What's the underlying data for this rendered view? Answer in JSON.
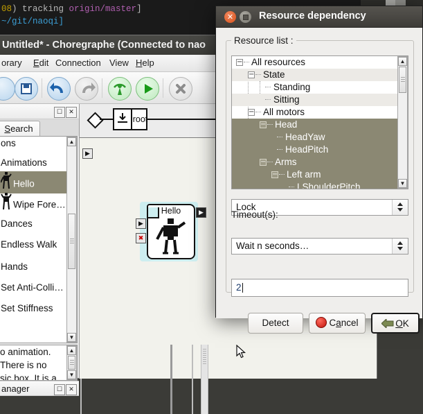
{
  "terminal": {
    "line1_pre": "08",
    "line1_mid": ") tracking ",
    "line1_branch": "origin/master",
    "line1_end": "]",
    "line2": "~/git/naoqi]"
  },
  "choregraphe": {
    "title": "Untitled* - Choregraphe (Connected to nao",
    "menu": [
      "orary",
      "Edit",
      "Connection",
      "View",
      "Help"
    ],
    "toolbar_icons": [
      "open-icon",
      "save-icon",
      "undo-icon",
      "redo-icon",
      "connect-icon",
      "play-icon",
      "stop-icon"
    ],
    "left_panel": {
      "float_button": "float-panel-icon",
      "close_button": "close-panel-icon",
      "tab": "Search",
      "items": [
        {
          "label": "ons",
          "icon": false
        },
        {
          "label": "Animations",
          "icon": false
        },
        {
          "label": "Hello",
          "icon": true,
          "selected": true
        },
        {
          "label": "Wipe Fore…",
          "icon": true
        },
        {
          "label": "Dances",
          "icon": false
        },
        {
          "label": "Endless Walk",
          "icon": false
        },
        {
          "label": "Hands",
          "icon": false
        },
        {
          "label": "Set Anti-Colli…",
          "icon": false
        },
        {
          "label": "Set Stiffness",
          "icon": false
        }
      ]
    },
    "doc_panel": {
      "lines": [
        "o animation.",
        "",
        "There is no",
        "sic box. It is a"
      ]
    },
    "bottom_panel": {
      "title": "anager"
    },
    "canvas": {
      "breadcrumb_root": "root",
      "box": {
        "name": "Hello",
        "icon": "robot-icon"
      }
    }
  },
  "dialog": {
    "title": "Resource dependency",
    "group_label": "Resource list :",
    "tree": [
      {
        "label": "All resources",
        "depth": 0,
        "expander": "minus",
        "selected": false
      },
      {
        "label": "State",
        "depth": 1,
        "expander": "minus",
        "selected": false
      },
      {
        "label": "Standing",
        "depth": 2,
        "expander": "none",
        "selected": false
      },
      {
        "label": "Sitting",
        "depth": 2,
        "expander": "none",
        "selected": false
      },
      {
        "label": "All motors",
        "depth": 1,
        "expander": "minus",
        "selected": false
      },
      {
        "label": "Head",
        "depth": 2,
        "expander": "minus",
        "selected": true
      },
      {
        "label": "HeadYaw",
        "depth": 3,
        "expander": "none",
        "selected": true
      },
      {
        "label": "HeadPitch",
        "depth": 3,
        "expander": "none",
        "selected": true
      },
      {
        "label": "Arms",
        "depth": 2,
        "expander": "minus",
        "selected": true
      },
      {
        "label": "Left arm",
        "depth": 3,
        "expander": "minus",
        "selected": true
      },
      {
        "label": "LShoulderPitch",
        "depth": 4,
        "expander": "none",
        "selected": true
      }
    ],
    "lock_combo": {
      "value": "Lock"
    },
    "timeout_label": "Timeout(s):",
    "timeout_combo": {
      "value": "Wait n seconds…"
    },
    "timeout_value": "2",
    "buttons": {
      "detect": "Detect",
      "cancel_pre": "C",
      "cancel_key": "a",
      "cancel_post": "ncel",
      "ok_key": "O",
      "ok_post": "K"
    }
  },
  "colors": {
    "selection": "#8b8873",
    "titlebar": "#3e3c38",
    "close_orange": "#d9541d",
    "box_cyan": "#cdeef0",
    "cancel_red": "#c0140b",
    "ok_green": "#7c8a52"
  }
}
